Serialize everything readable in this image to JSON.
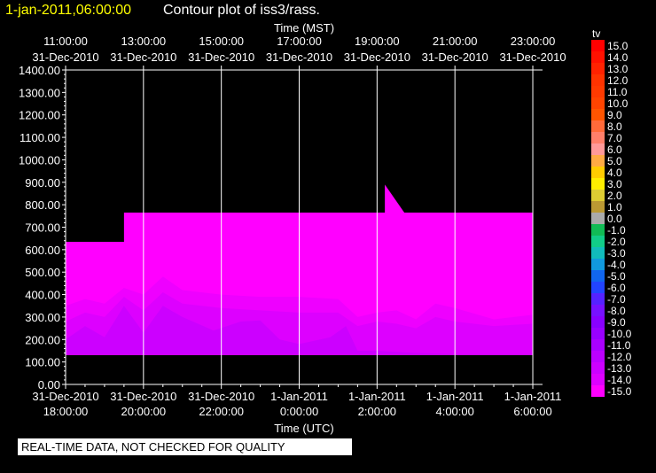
{
  "header": {
    "timestamp": "1-jan-2011,06:00:00",
    "title": "Contour plot of iss3/rass."
  },
  "footer": {
    "quality_note": "REAL-TIME DATA, NOT CHECKED FOR QUALITY"
  },
  "colorbar": {
    "title": "tv",
    "levels": [
      "15.0",
      "14.0",
      "13.0",
      "12.0",
      "11.0",
      "10.0",
      "9.0",
      "8.0",
      "7.0",
      "6.0",
      "5.0",
      "4.0",
      "3.0",
      "2.0",
      "1.0",
      "0.0",
      "-1.0",
      "-2.0",
      "-3.0",
      "-4.0",
      "-5.0",
      "-6.0",
      "-7.0",
      "-8.0",
      "-9.0",
      "-10.0",
      "-11.0",
      "-12.0",
      "-13.0",
      "-14.0",
      "-15.0"
    ],
    "colors": [
      "#ff0000",
      "#ff1100",
      "#ff2200",
      "#ff3300",
      "#ff3a00",
      "#ff4400",
      "#ff5500",
      "#ff6a3a",
      "#ff7f6a",
      "#ff9999",
      "#ffaa44",
      "#ffcc00",
      "#ffee00",
      "#ddcc33",
      "#bb9933",
      "#aaaaaa",
      "#11bb55",
      "#11cc88",
      "#11bbbb",
      "#1199dd",
      "#1166ee",
      "#2244ff",
      "#5522ff",
      "#7711ff",
      "#8800ff",
      "#9900ff",
      "#aa00ff",
      "#bb00ff",
      "#cc00ff",
      "#dd00ff",
      "#ff00ff"
    ]
  },
  "chart_data": {
    "type": "heatmap",
    "xlabel_top": "Time (MST)",
    "xlabel_bottom": "Time (UTC)",
    "ylim": [
      0,
      1400
    ],
    "xlim_hours_utc": [
      18,
      30.25
    ],
    "yticks": [
      "0.00",
      "100.00",
      "200.00",
      "300.00",
      "400.00",
      "500.00",
      "600.00",
      "700.00",
      "800.00",
      "900.00",
      "1000.00",
      "1100.00",
      "1200.00",
      "1300.00",
      "1400.00"
    ],
    "top_ticks": [
      {
        "time": "11:00:00",
        "date": "31-Dec-2010"
      },
      {
        "time": "13:00:00",
        "date": "31-Dec-2010"
      },
      {
        "time": "15:00:00",
        "date": "31-Dec-2010"
      },
      {
        "time": "17:00:00",
        "date": "31-Dec-2010"
      },
      {
        "time": "19:00:00",
        "date": "31-Dec-2010"
      },
      {
        "time": "21:00:00",
        "date": "31-Dec-2010"
      },
      {
        "time": "23:00:00",
        "date": "31-Dec-2010"
      }
    ],
    "bottom_ticks": [
      {
        "date": "31-Dec-2010",
        "time": "18:00:00"
      },
      {
        "date": "31-Dec-2010",
        "time": "20:00:00"
      },
      {
        "date": "31-Dec-2010",
        "time": "22:00:00"
      },
      {
        "date": "1-Jan-2011",
        "time": "0:00:00"
      },
      {
        "date": "1-Jan-2011",
        "time": "2:00:00"
      },
      {
        "date": "1-Jan-2011",
        "time": "4:00:00"
      },
      {
        "date": "1-Jan-2011",
        "time": "6:00:00"
      }
    ],
    "data_top_envelope": [
      [
        18.0,
        635
      ],
      [
        19.5,
        635
      ],
      [
        19.5,
        765
      ],
      [
        26.2,
        765
      ],
      [
        26.2,
        890
      ],
      [
        26.7,
        765
      ],
      [
        30.0,
        765
      ]
    ],
    "data_bottom": 130,
    "contours": [
      {
        "level": "-13.0",
        "color": "#ee00ff",
        "top": [
          [
            18.0,
            350
          ],
          [
            18.5,
            380
          ],
          [
            19.0,
            360
          ],
          [
            19.5,
            430
          ],
          [
            20.0,
            400
          ],
          [
            20.5,
            480
          ],
          [
            21.0,
            420
          ],
          [
            22.0,
            400
          ],
          [
            23.0,
            390
          ],
          [
            24.0,
            390
          ],
          [
            25.0,
            380
          ],
          [
            25.5,
            300
          ],
          [
            26.0,
            320
          ],
          [
            26.5,
            330
          ],
          [
            27.0,
            290
          ],
          [
            27.5,
            360
          ],
          [
            28.0,
            340
          ],
          [
            29.0,
            290
          ],
          [
            30.0,
            310
          ]
        ]
      },
      {
        "level": "-12.0",
        "color": "#dd00ff",
        "top": [
          [
            18.0,
            280
          ],
          [
            18.5,
            320
          ],
          [
            19.0,
            300
          ],
          [
            19.5,
            390
          ],
          [
            20.0,
            330
          ],
          [
            20.5,
            410
          ],
          [
            21.0,
            360
          ],
          [
            22.0,
            340
          ],
          [
            23.0,
            330
          ],
          [
            24.0,
            320
          ],
          [
            25.0,
            320
          ],
          [
            25.5,
            260
          ],
          [
            26.0,
            280
          ],
          [
            26.5,
            270
          ],
          [
            27.0,
            250
          ],
          [
            27.5,
            300
          ],
          [
            28.0,
            280
          ],
          [
            29.0,
            260
          ],
          [
            30.0,
            270
          ]
        ]
      },
      {
        "level": "-11.0",
        "color": "#cc00ff",
        "top": [
          [
            18.0,
            200
          ],
          [
            18.5,
            260
          ],
          [
            19.0,
            210
          ],
          [
            19.5,
            350
          ],
          [
            20.0,
            230
          ],
          [
            20.5,
            350
          ],
          [
            21.0,
            300
          ],
          [
            21.8,
            240
          ],
          [
            22.5,
            280
          ],
          [
            23.0,
            285
          ],
          [
            23.5,
            200
          ],
          [
            24.0,
            180
          ],
          [
            24.8,
            210
          ],
          [
            25.2,
            260
          ],
          [
            25.5,
            150
          ],
          [
            26.0,
            150
          ],
          [
            27.0,
            140
          ],
          [
            28.0,
            135
          ],
          [
            30.0,
            135
          ]
        ]
      }
    ]
  }
}
